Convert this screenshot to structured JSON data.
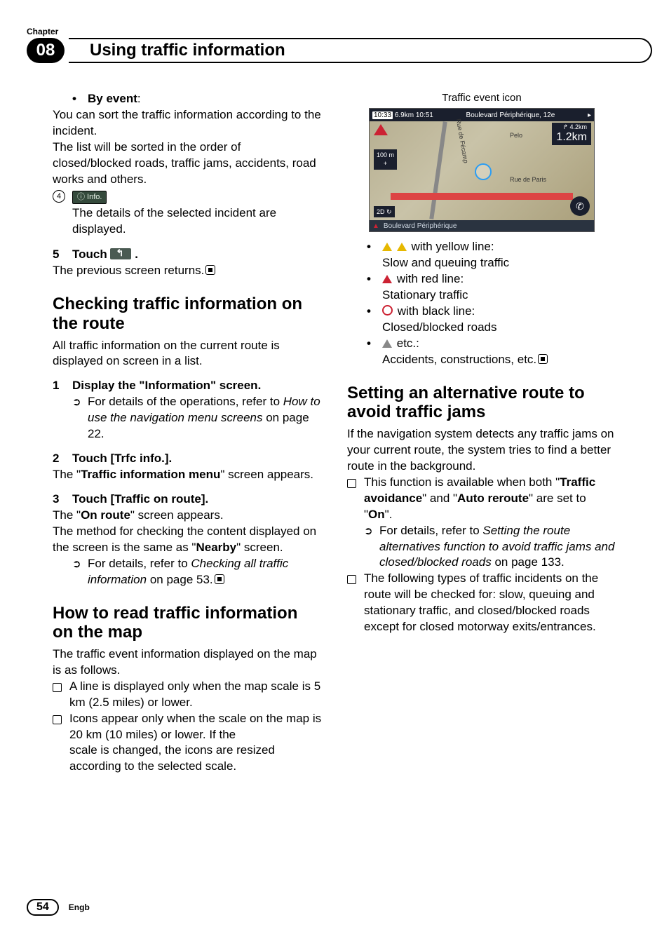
{
  "header": {
    "chapter_label": "Chapter",
    "chapter_number": "08",
    "title": "Using traffic information"
  },
  "col1": {
    "by_event_label": "By event",
    "by_event_colon": ":",
    "by_event_line1": "You can sort the traffic information according to the incident.",
    "by_event_line2": "The list will be sorted in the order of closed/blocked roads, traffic jams, accidents, road works and others.",
    "circ4": "4",
    "info_btn": "ⓘ Info.",
    "info_line": "The details of the selected incident are displayed.",
    "step5_num": "5",
    "step5_label": "Touch ",
    "step5_period": ".",
    "step5_result": "The previous screen returns.",
    "sec_check_title": "Checking traffic information on the route",
    "sec_check_intro": "All traffic information on the current route is displayed on screen in a list.",
    "s1_num": "1",
    "s1_label": "Display the \"Information\" screen.",
    "s1_hint_a": "For details of the operations, refer to ",
    "s1_hint_i": "How to use the navigation menu screens",
    "s1_hint_b": " on page 22.",
    "s2_num": "2",
    "s2_label": "Touch [Trfc info.].",
    "s2_res_a": "The \"",
    "s2_res_b": "Traffic information menu",
    "s2_res_c": "\" screen appears.",
    "s3_num": "3",
    "s3_label": "Touch [Traffic on route].",
    "s3_res1_a": "The \"",
    "s3_res1_b": "On route",
    "s3_res1_c": "\" screen appears.",
    "s3_res2_a": "The method for checking the content displayed on the screen is the same as \"",
    "s3_res2_b": "Nearby",
    "s3_res2_c": "\" screen.",
    "s3_hint_a": "For details, refer to ",
    "s3_hint_i": "Checking all traffic information",
    "s3_hint_b": " on page 53.",
    "sec_read_title": "How to read traffic information on the map",
    "sec_read_intro": "The traffic event information displayed on the map is as follows.",
    "read_n1": "A line is displayed only when the map scale is 5 km (2.5 miles) or lower.",
    "read_n2": "Icons appear only when the scale on the map is 20 km (10 miles) or lower. If the"
  },
  "col2": {
    "cont": "scale is changed, the icons are resized according to the selected scale.",
    "map_caption": "Traffic event icon",
    "map": {
      "time": "10:33",
      "dist_top": "6.9km",
      "dist_top2": "10:51",
      "street_top": "Boulevard Périphérique, 12e",
      "dist1": "4.2km",
      "dist2": "1.2km",
      "scale": "100 m",
      "compass": "2D",
      "street_bot": "Boulevard Périphérique",
      "label1": "Rue de Fécamp",
      "label2": "Pelo",
      "label3": "Rue de Paris"
    },
    "li1a": " with yellow line:",
    "li1b": "Slow and queuing traffic",
    "li2a": " with red line:",
    "li2b": "Stationary traffic",
    "li3a": " with black line:",
    "li3b": "Closed/blocked roads",
    "li4a": " etc.:",
    "li4b": "Accidents, constructions, etc.",
    "sec_alt_title": "Setting an alternative route to avoid traffic jams",
    "sec_alt_intro": "If the navigation system detects any traffic jams on your current route, the system tries to find a better route in the background.",
    "alt_n1_a": "This function is available when both \"",
    "alt_n1_b": "Traffic avoidance",
    "alt_n1_c": "\" and \"",
    "alt_n1_d": "Auto reroute",
    "alt_n1_e": "\" are set to \"",
    "alt_n1_f": "On",
    "alt_n1_g": "\".",
    "alt_h_a": "For details, refer to ",
    "alt_h_i": "Setting the route alternatives function to avoid traffic jams and closed/blocked roads",
    "alt_h_b": " on page 133.",
    "alt_n2": "The following types of traffic incidents on the route will be checked for: slow, queuing and stationary traffic, and closed/blocked roads except for closed motorway exits/entrances."
  },
  "footer": {
    "page": "54",
    "lang": "Engb"
  }
}
